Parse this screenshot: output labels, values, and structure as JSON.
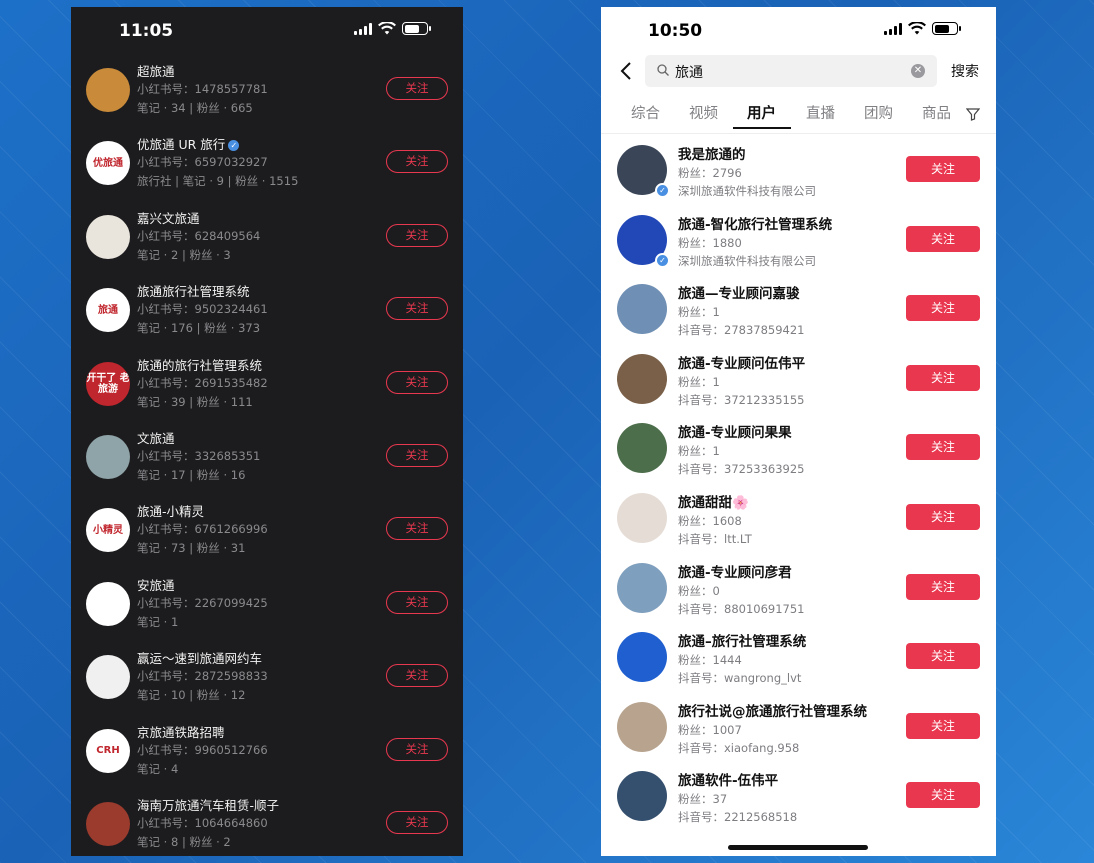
{
  "left_phone": {
    "time": "11:05",
    "follow_label": "关注",
    "rows": [
      {
        "name": "超旅通",
        "id": "小红书号：1478557781",
        "meta": "笔记 · 34 | 粉丝 · 665",
        "avatar_text": "",
        "avatar_color": "#c98b3a",
        "verified": false
      },
      {
        "name": "优旅通 UR 旅行",
        "id": "小红书号：6597032927",
        "meta": "旅行社 | 笔记 · 9 | 粉丝 · 1515",
        "avatar_text": "优旅通",
        "avatar_color": "#ffffff",
        "verified": true
      },
      {
        "name": "嘉兴文旅通",
        "id": "小红书号：628409564",
        "meta": "笔记 · 2 | 粉丝 · 3",
        "avatar_text": "",
        "avatar_color": "#e9e4dc",
        "verified": false
      },
      {
        "name": "旅通旅行社管理系统",
        "id": "小红书号：9502324461",
        "meta": "笔记 · 176 | 粉丝 · 373",
        "avatar_text": "旅通",
        "avatar_color": "#ffffff",
        "verified": false
      },
      {
        "name": "旅通的旅行社管理系统",
        "id": "小红书号：2691535482",
        "meta": "笔记 · 39 | 粉丝 · 111",
        "avatar_text": "开干了 老旅游",
        "avatar_color": "#c0262d",
        "verified": false
      },
      {
        "name": "文旅通",
        "id": "小红书号：332685351",
        "meta": "笔记 · 17 | 粉丝 · 16",
        "avatar_text": "",
        "avatar_color": "#8fa4a8",
        "verified": false
      },
      {
        "name": "旅通-小精灵",
        "id": "小红书号：6761266996",
        "meta": "笔记 · 73 | 粉丝 · 31",
        "avatar_text": "小精灵",
        "avatar_color": "#ffffff",
        "verified": false
      },
      {
        "name": "安旅通",
        "id": "小红书号：2267099425",
        "meta": "笔记 · 1",
        "avatar_text": "",
        "avatar_color": "#ffffff",
        "verified": false
      },
      {
        "name": "赢运～速到旅通网约车",
        "id": "小红书号：2872598833",
        "meta": "笔记 · 10 | 粉丝 · 12",
        "avatar_text": "",
        "avatar_color": "#f0f0f0",
        "verified": false
      },
      {
        "name": "京旅通铁路招聘",
        "id": "小红书号：9960512766",
        "meta": "笔记 · 4",
        "avatar_text": "CRH",
        "avatar_color": "#ffffff",
        "verified": false
      },
      {
        "name": "海南万旅通汽车租赁-顺子",
        "id": "小红书号：1064664860",
        "meta": "笔记 · 8 | 粉丝 · 2",
        "avatar_text": "",
        "avatar_color": "#9a3b2e",
        "verified": false
      }
    ]
  },
  "right_phone": {
    "time": "10:50",
    "search_query": "旅通",
    "search_button": "搜索",
    "tabs": [
      "综合",
      "视频",
      "用户",
      "直播",
      "团购",
      "商品"
    ],
    "active_tab": "用户",
    "follow_label": "关注",
    "rows": [
      {
        "name": "我是旅通的",
        "fans": "粉丝：2796",
        "sub": "深圳旅通软件科技有限公司",
        "avatar_color": "#3a4658",
        "verified": true
      },
      {
        "name": "旅通-智化旅行社管理系统",
        "fans": "粉丝：1880",
        "sub": "深圳旅通软件科技有限公司",
        "avatar_color": "#2248b8",
        "verified": true
      },
      {
        "name": "旅通—专业顾问嘉骏",
        "fans": "粉丝：1",
        "sub": "抖音号：27837859421",
        "avatar_color": "#6f8fb4",
        "verified": false
      },
      {
        "name": "旅通-专业顾问伍伟平",
        "fans": "粉丝：1",
        "sub": "抖音号：37212335155",
        "avatar_color": "#7a6048",
        "verified": false
      },
      {
        "name": "旅通-专业顾问果果",
        "fans": "粉丝：1",
        "sub": "抖音号：37253363925",
        "avatar_color": "#4c6e4a",
        "verified": false
      },
      {
        "name": "旅通甜甜🌸",
        "fans": "粉丝：1608",
        "sub": "抖音号：ltt.LT",
        "avatar_color": "#e6dcd6",
        "verified": false
      },
      {
        "name": "旅通-专业顾问彦君",
        "fans": "粉丝：0",
        "sub": "抖音号：88010691751",
        "avatar_color": "#7f9fbe",
        "verified": false
      },
      {
        "name": "旅通–旅行社管理系统",
        "fans": "粉丝：1444",
        "sub": "抖音号：wangrong_lvt",
        "avatar_color": "#1f5fcf",
        "verified": false
      },
      {
        "name": "旅行社说@旅通旅行社管理系统",
        "fans": "粉丝：1007",
        "sub": "抖音号：xiaofang.958",
        "avatar_color": "#b8a48e",
        "verified": false
      },
      {
        "name": "旅通软件-伍伟平",
        "fans": "粉丝：37",
        "sub": "抖音号：2212568518",
        "avatar_color": "#35506e",
        "verified": false
      }
    ]
  }
}
